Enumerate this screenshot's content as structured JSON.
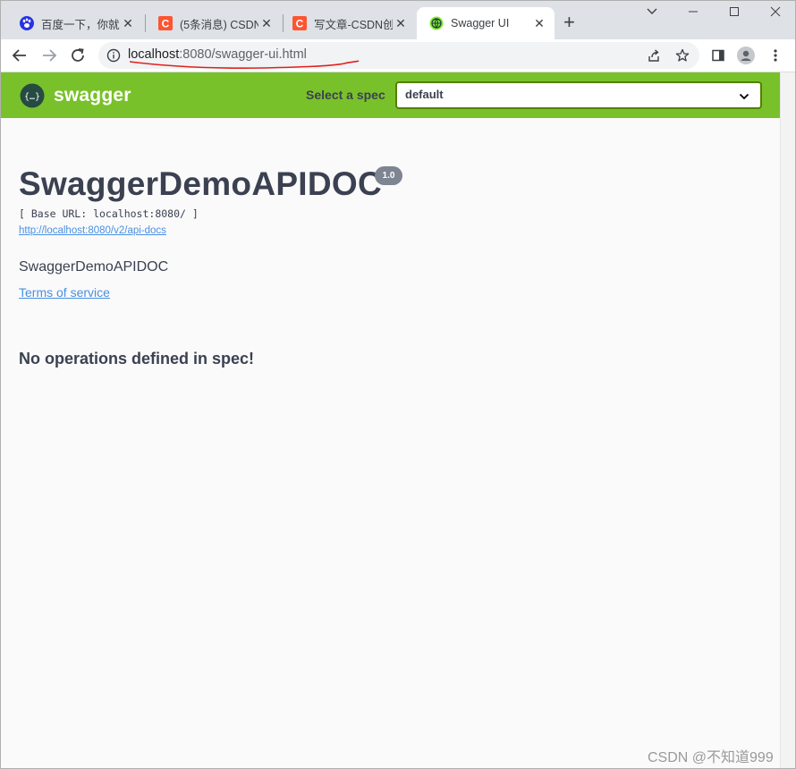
{
  "browser": {
    "tabs": [
      {
        "title": "百度一下，你就",
        "favicon": "baidu-paw-icon",
        "close": "✕"
      },
      {
        "title": "(5条消息) CSDN",
        "favicon": "csdn-c-icon",
        "close": "✕"
      },
      {
        "title": "写文章-CSDN创",
        "favicon": "csdn-c-icon",
        "close": "✕"
      },
      {
        "title": "Swagger UI",
        "favicon": "swagger-globe-icon",
        "close": "✕"
      }
    ],
    "new_tab": "+",
    "url_host": "localhost",
    "url_rest": ":8080/swagger-ui.html",
    "colors": {
      "tabbar": "#dee1e6",
      "csdn": "#fc5531",
      "baidu": "#2932e1"
    }
  },
  "swagger": {
    "logo_text": "swagger",
    "spec_label": "Select a spec",
    "spec_value": "default",
    "brand_color": "#79c12a",
    "title": "SwaggerDemoAPIDOC",
    "version": "1.0",
    "base_url": "[ Base URL: localhost:8080/ ]",
    "spec_link": "http://localhost:8080/v2/api-docs",
    "description": "SwaggerDemoAPIDOC",
    "terms": "Terms of service",
    "no_ops": "No operations defined in spec!"
  },
  "watermark": "CSDN @不知道999"
}
